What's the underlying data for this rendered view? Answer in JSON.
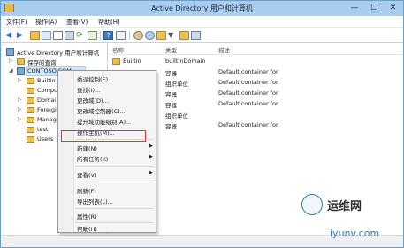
{
  "window": {
    "title": "Active Directory 用户和计算机",
    "controls": {
      "minimize": "—",
      "maximize": "☐",
      "close": "✕"
    }
  },
  "menubar": {
    "items": [
      "文件(F)",
      "操作(A)",
      "查看(V)",
      "帮助(H)"
    ]
  },
  "toolbar": {
    "buttons": [
      "back-icon",
      "forward-icon",
      "up-icon",
      "show-tree-icon",
      "copy-icon",
      "properties-icon",
      "refresh-icon",
      "export-icon",
      "help-icon",
      "console-icon",
      "new-user-icon",
      "new-group-icon",
      "new-ou-icon",
      "filter-icon",
      "find-icon",
      "add-to-group-icon"
    ]
  },
  "tree": {
    "root": "Active Directory 用户和计算机",
    "items": [
      {
        "label": "保存的查询",
        "expander": "▷"
      },
      {
        "label": "CONTOSO.COM",
        "expander": "◢"
      },
      {
        "label": "Builtin",
        "expander": "▷"
      },
      {
        "label": "Compu",
        "expander": ""
      },
      {
        "label": "Domai",
        "expander": "▷"
      },
      {
        "label": "Foreigi",
        "expander": "▷"
      },
      {
        "label": "Manag",
        "expander": "▷"
      },
      {
        "label": "test",
        "expander": ""
      },
      {
        "label": "Users",
        "expander": ""
      }
    ]
  },
  "list": {
    "columns": [
      "名称",
      "类型",
      "描述"
    ],
    "rows": [
      {
        "name": "Builtin",
        "type": "builtinDomain",
        "desc": ""
      },
      {
        "name": "",
        "type": "容器",
        "desc": "Default container for"
      },
      {
        "name": "",
        "type": "组织单位",
        "desc": "Default container for"
      },
      {
        "name": "",
        "type": "容器",
        "desc": "Default container for"
      },
      {
        "name": "",
        "type": "容器",
        "desc": "Default container for"
      },
      {
        "name": "",
        "type": "组织单位",
        "desc": ""
      },
      {
        "name": "",
        "type": "容器",
        "desc": "Default container for"
      }
    ]
  },
  "context_menu": {
    "items": [
      {
        "label": "委派控制(E)...",
        "arrow": ""
      },
      {
        "label": "查找(I)...",
        "arrow": ""
      },
      {
        "label": "更改域(D)...",
        "arrow": ""
      },
      {
        "label": "更改域控制器(C)...",
        "arrow": ""
      },
      {
        "label": "提升域功能级别(A)...",
        "arrow": ""
      },
      {
        "label": "操作主机(M)...",
        "arrow": "",
        "highlighted": true
      },
      {
        "label": "新建(N)",
        "arrow": "▶"
      },
      {
        "label": "所有任务(K)",
        "arrow": "▶"
      },
      {
        "label": "查看(V)",
        "arrow": "▶"
      },
      {
        "label": "刷新(F)",
        "arrow": ""
      },
      {
        "label": "导出列表(L)...",
        "arrow": ""
      },
      {
        "label": "属性(R)",
        "arrow": ""
      },
      {
        "label": "帮助(H)",
        "arrow": ""
      }
    ],
    "highlight_color": "#e0343a"
  },
  "watermark": {
    "brand": "运维网",
    "url": "iyunv.com"
  },
  "colors": {
    "titlebar": "#a9cdef",
    "selection": "#cde8ff",
    "folder": "#e9c157"
  }
}
